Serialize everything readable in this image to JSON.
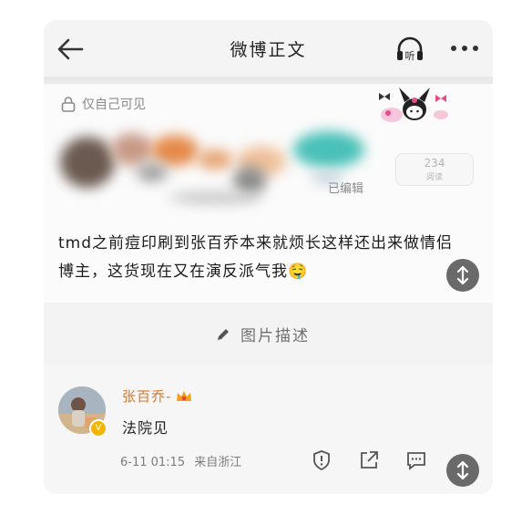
{
  "header": {
    "title": "微博正文",
    "back_icon": "arrow-left-icon",
    "listen_icon": "headphones-icon",
    "listen_label": "听",
    "more_icon": "more-dots-icon"
  },
  "post": {
    "privacy_label": "仅自己可见",
    "privacy_icon": "lock-icon",
    "edited_label": "已编辑",
    "read_count": "234",
    "read_label": "阅读",
    "text": "tmd之前痘印刷到张百乔本来就烦长这样还出来做情侣博主，这货现在又在演反派气我🤤"
  },
  "image_description": {
    "label": "图片描述",
    "icon": "pencil-icon"
  },
  "comment": {
    "author": "张百乔-",
    "badge_icon": "crown-badge-icon",
    "verified_icon": "verified-v-icon",
    "text": "法院见",
    "time": "6-11 01:15",
    "location": "来自浙江",
    "actions": [
      "report-icon",
      "share-icon",
      "comment-icon",
      "more-icon"
    ]
  },
  "colors": {
    "username": "#d9762b",
    "fab": "#6a6a6a",
    "muted": "#8a8a8a"
  }
}
